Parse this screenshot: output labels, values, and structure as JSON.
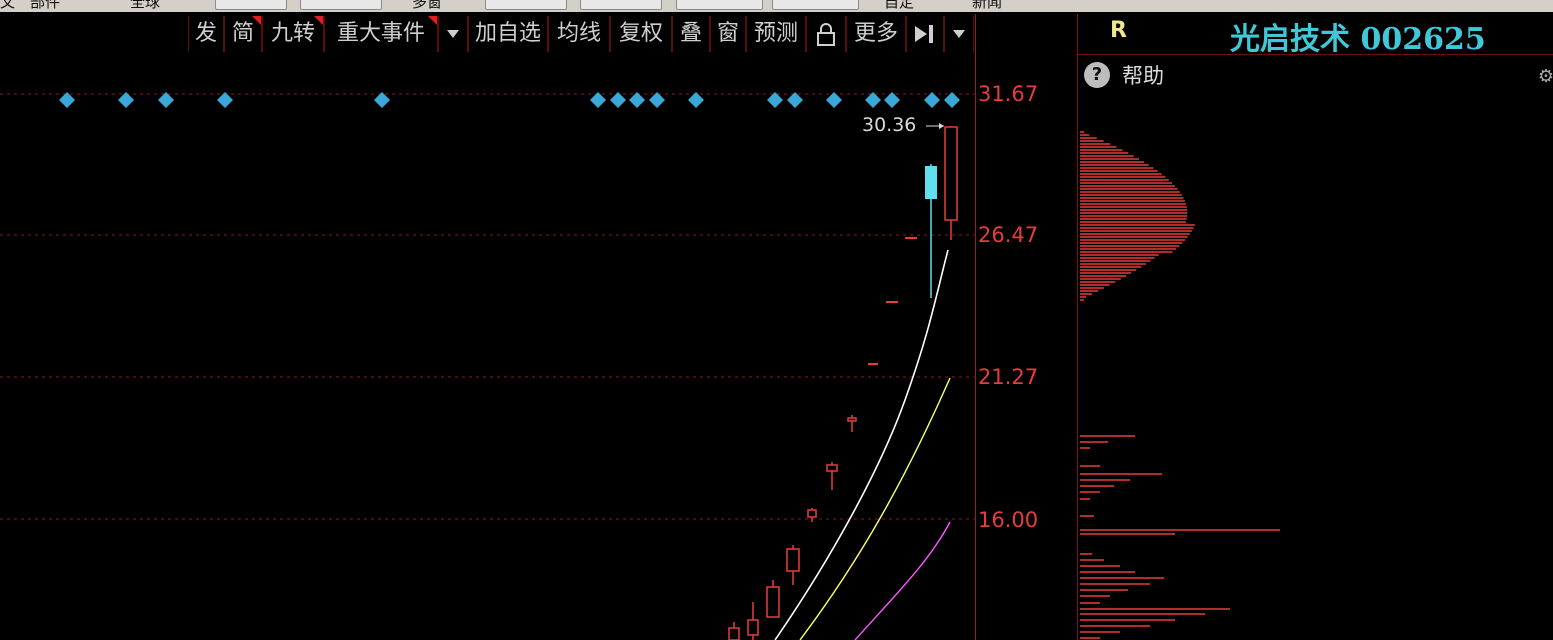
{
  "top_strip": {
    "texts": [
      "文",
      "部件",
      "全球",
      "多窗",
      "自定",
      "新闻"
    ]
  },
  "toolbar": {
    "buttons": [
      {
        "label": "发",
        "flag": false
      },
      {
        "label": "简",
        "flag": true
      },
      {
        "label": "九转",
        "flag": true
      },
      {
        "label": "重大事件",
        "flag": true
      },
      {
        "label": "加自选",
        "flag": false
      },
      {
        "label": "均线",
        "flag": false
      },
      {
        "label": "复权",
        "flag": false
      },
      {
        "label": "叠",
        "flag": false
      },
      {
        "label": "窗",
        "flag": false
      },
      {
        "label": "预测",
        "flag": false
      },
      {
        "label": "更多",
        "flag": false
      }
    ],
    "icons": {
      "dropdown": "chevron-down-icon",
      "lock": "lock-icon",
      "collapse": "arrow-right-bar-icon"
    }
  },
  "chart": {
    "price_levels": [
      "31.67",
      "26.47",
      "21.27",
      "16.00"
    ],
    "last_price_label": "30.36",
    "colors": {
      "up": "#e83c3c",
      "down": "#5fe0f0",
      "ma_white": "#ffffff",
      "ma_yellow": "#ffff66",
      "ma_magenta": "#ff55ff",
      "signal": "#3aa8d8",
      "grid": "#8b1a1a"
    }
  },
  "right_panel": {
    "r_label": "R",
    "stock_title": "光启技术 002625",
    "help_label": "帮助",
    "help_icon": "question-icon",
    "settings_icon": "gear-icon"
  }
}
